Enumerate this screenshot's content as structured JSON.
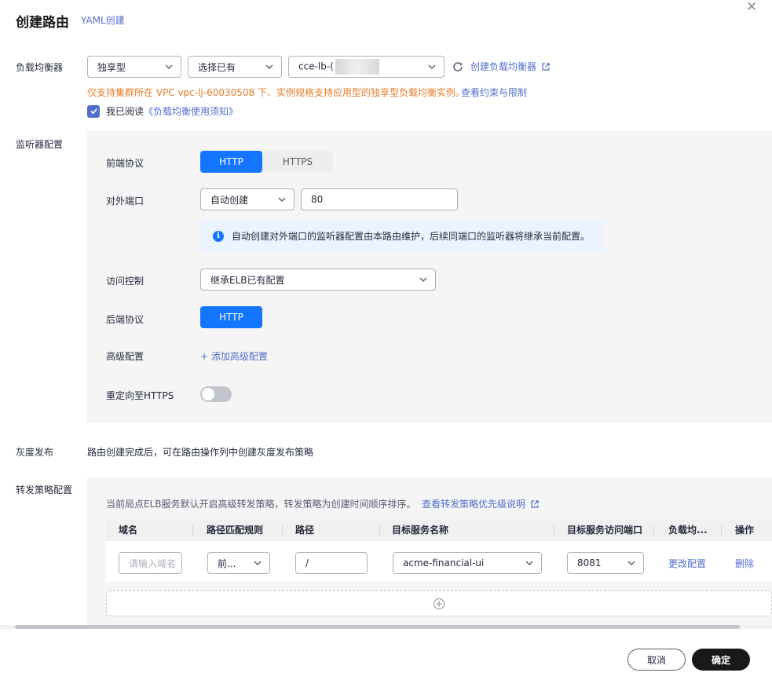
{
  "header": {
    "title": "创建路由",
    "yaml_link": "YAML创建"
  },
  "load_balancer": {
    "label": "负载均衡器",
    "type_select": "独享型",
    "mode_select": "选择已有",
    "lb_select_prefix": "cce-lb-(",
    "create_link": "创建负载均衡器",
    "warning": "仅支持集群所在 VPC vpc-lj-60030508 下、实例规格支持应用型的独享型负载均衡实例。",
    "constraints_link": "查看约束与限制",
    "agree_text": "我已阅读",
    "agree_link": "《负载均衡使用须知》"
  },
  "listener": {
    "label": "监听器配置",
    "frontend_protocol_label": "前端协议",
    "frontend_options": [
      "HTTP",
      "HTTPS"
    ],
    "frontend_selected": "HTTP",
    "external_port_label": "对外端口",
    "port_mode": "自动创建",
    "port_value": "80",
    "info_text": "自动创建对外端口的监听器配置由本路由维护，后续同端口的监听器将继承当前配置。",
    "access_control_label": "访问控制",
    "access_control_value": "继承ELB已有配置",
    "backend_protocol_label": "后端协议",
    "backend_protocol": "HTTP",
    "advanced_label": "高级配置",
    "add_advanced": "添加高级配置",
    "redirect_label": "重定向至HTTPS",
    "redirect_enabled": false
  },
  "grayscale": {
    "label": "灰度发布",
    "text": "路由创建完成后，可在路由操作列中创建灰度发布策略"
  },
  "forwarding": {
    "label": "转发策略配置",
    "note": "当前局点ELB服务默认开启高级转发策略，转发策略为创建时间顺序排序。",
    "priority_link": "查看转发策略优先级说明",
    "columns": [
      "域名",
      "路径匹配规则",
      "路径",
      "目标服务名称",
      "目标服务访问端口",
      "负载均...",
      "操作"
    ],
    "row": {
      "domain_placeholder": "请输入域名",
      "match_rule": "前...",
      "path": "/",
      "service": "acme-financial-ui",
      "port": "8081",
      "lb_action": "更改配置",
      "delete": "删除"
    }
  },
  "footer": {
    "cancel": "取消",
    "confirm": "确定"
  },
  "colors": {
    "accent": "#526ecc",
    "primary_blue": "#1476ff",
    "warning": "#e37d29",
    "panel_bg": "#f5f5f6"
  }
}
